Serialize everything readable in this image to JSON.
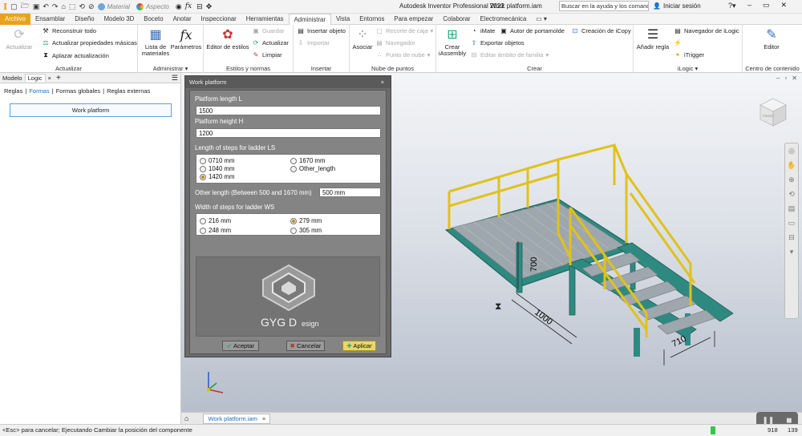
{
  "titlebar": {
    "app_letter": "I",
    "material": "Material",
    "appearance": "Aspecto",
    "fx": "fx",
    "title": "Autodesk Inventor Professional 2022",
    "file": "Work platform.iam",
    "search_placeholder": "Buscar en la ayuda y los comandos",
    "signin": "Iniciar sesión",
    "help": "?",
    "min": "–",
    "max": "▭",
    "close": "✕"
  },
  "tabs": [
    "Archivo",
    "Ensamblar",
    "Diseño",
    "Modelo 3D",
    "Boceto",
    "Anotar",
    "Inspeccionar",
    "Herramientas",
    "Administrar",
    "Vista",
    "Entornos",
    "Para empezar",
    "Colaborar",
    "Electromecánica"
  ],
  "ribbon": {
    "actualizar_group": {
      "title": "Actualizar",
      "big": "Actualizar",
      "items": [
        "Reconstruir todo",
        "Actualizar propiedades másicas",
        "Aplazar actualización"
      ]
    },
    "administrar_group": {
      "title": "Administrar",
      "lista": "Lista de materiales",
      "parametros": "Parámetros"
    },
    "estilos_group": {
      "title": "Estilos y normas",
      "editor": "Editor de estilos",
      "items": [
        "Guardar",
        "Actualizar",
        "Limpiar"
      ]
    },
    "insertar_group": {
      "title": "Insertar",
      "items": [
        "Insertar objeto",
        "Importar"
      ]
    },
    "nube_group": {
      "title": "Nube de puntos",
      "asociar": "Asociar",
      "items": [
        "Recorte de caja",
        "Navegador",
        "Punto de nube"
      ]
    },
    "crear_group": {
      "title": "Crear",
      "crear": "Crear iAssembly",
      "items": [
        "iMate",
        "Autor de portamolde",
        "Creación de iCopy",
        "Exportar objetos",
        "Editar ámbito de familia"
      ]
    },
    "ilogic_group": {
      "title": "iLogic",
      "anadir": "Añadir regla",
      "items": [
        "Navegador de iLogic",
        "iTrigger"
      ]
    },
    "contenido_group": {
      "title": "Centro de contenido",
      "editor": "Editor"
    }
  },
  "leftpanel": {
    "tabs": [
      "Modelo",
      "Logic"
    ],
    "close": "×",
    "add": "+",
    "sub": [
      "Reglas",
      "Formas",
      "Formas globales",
      "Reglas externas"
    ],
    "button": "Work platform"
  },
  "dialog": {
    "title": "Work platform",
    "close": "×",
    "platform_length_label": "Platform length L",
    "platform_length_value": "1500",
    "platform_height_label": "Platform height H",
    "platform_height_value": "1200",
    "ls_label": "Length of steps for ladder LS",
    "ls_options": [
      {
        "label": "0710 mm",
        "selected": false
      },
      {
        "label": "1670 mm",
        "selected": false
      },
      {
        "label": "1040 mm",
        "selected": false
      },
      {
        "label": "Other_length",
        "selected": false
      },
      {
        "label": "1420 mm",
        "selected": true
      }
    ],
    "other_length_label": "Other length (Between 500 and 1670 mm)",
    "other_length_value": "500 mm",
    "ws_label": "Width of steps for ladder WS",
    "ws_options": [
      {
        "label": "216 mm",
        "selected": false
      },
      {
        "label": "279 mm",
        "selected": true
      },
      {
        "label": "248 mm",
        "selected": false
      },
      {
        "label": "305 mm",
        "selected": false
      }
    ],
    "logo_text": "GYG D",
    "logo_sub": "esign",
    "btn_ok": "Aceptar",
    "btn_cancel": "Cancelar",
    "btn_apply": "Aplicar"
  },
  "viewport": {
    "dims": {
      "h": "700",
      "l": "1000",
      "w": "710"
    },
    "viewcube_face": "FRONT"
  },
  "doctab": {
    "label": "Work platform.iam",
    "close": "×"
  },
  "status": {
    "message": "<Esc> para cancelar; Ejecutando Cambiar la posición del componente",
    "n1": "918",
    "n2": "139"
  },
  "colors": {
    "accent": "#e8a21e",
    "rail": "#e0c21a",
    "frame": "#2e8a80",
    "link": "#1f6fc5"
  }
}
